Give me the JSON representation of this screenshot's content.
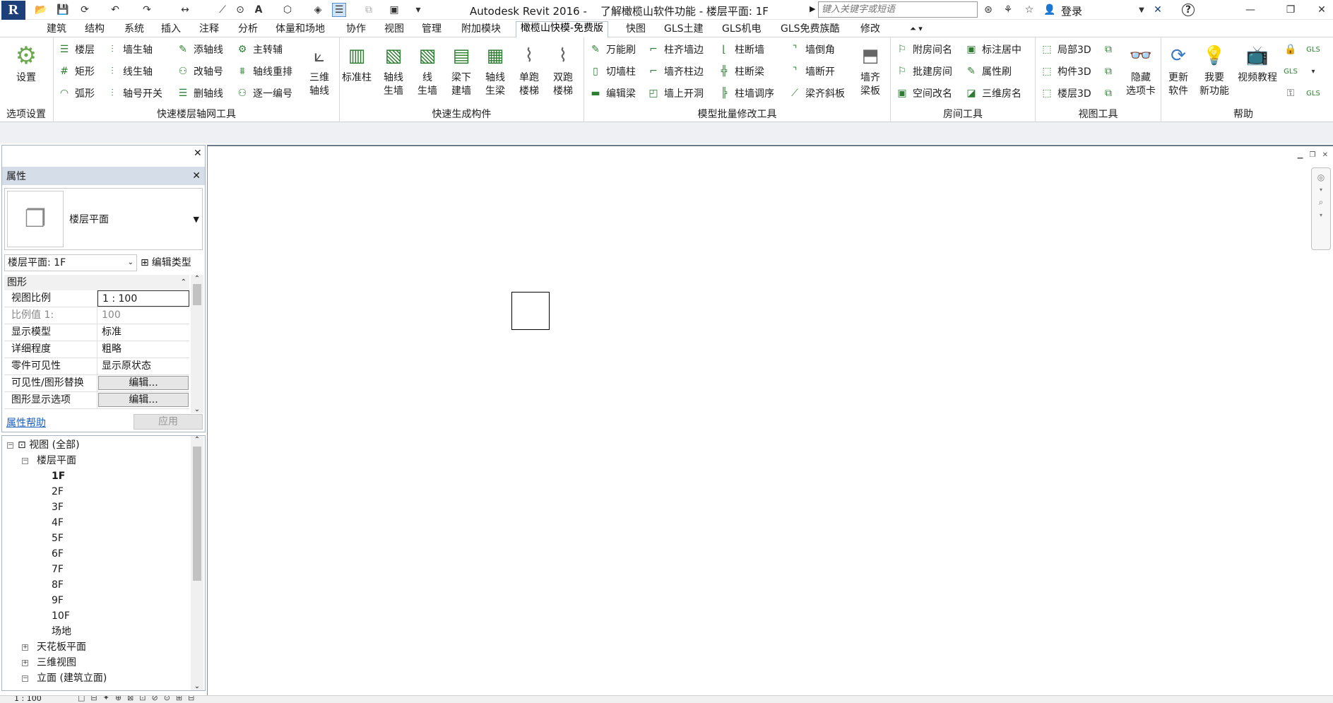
{
  "app": {
    "title": "Autodesk Revit 2016 -    了解橄榄山软件功能 - 楼层平面: 1F",
    "search_placeholder": "键入关键字或短语",
    "login_label": "登录"
  },
  "tabs": [
    "建筑",
    "结构",
    "系统",
    "插入",
    "注释",
    "分析",
    "体量和场地",
    "协作",
    "视图",
    "管理",
    "附加模块",
    "橄榄山快模-免费版",
    "快图",
    "GLS土建",
    "GLS机电",
    "GLS免费族酷",
    "修改"
  ],
  "active_tab_index": 11,
  "ribbon": {
    "settings": {
      "label": "设置",
      "panel": "选项设置"
    },
    "axis_panel": {
      "title": "快速楼层轴网工具",
      "col1": [
        "楼层",
        "矩形",
        "弧形"
      ],
      "col2": [
        "墙生轴",
        "线生轴",
        "轴号开关"
      ],
      "col3": [
        "添轴线",
        "改轴号",
        "删轴线"
      ],
      "col4": [
        "主转辅",
        "轴线重排",
        "逐一编号"
      ],
      "big": "三维\n轴线"
    },
    "component_panel": {
      "title": "快速生成构件",
      "big": [
        "标准柱",
        "轴线\n生墙",
        "线\n生墙",
        "梁下\n建墙",
        "轴线\n生梁",
        "单跑\n楼梯",
        "双跑\n楼梯"
      ]
    },
    "modify_panel": {
      "title": "模型批量修改工具",
      "col1": [
        "万能刷",
        "切墙柱",
        "编辑梁"
      ],
      "col2": [
        "柱齐墙边",
        "墙齐柱边",
        "墙上开洞"
      ],
      "col3": [
        "柱断墙",
        "柱断梁",
        "柱墙调序"
      ],
      "col4": [
        "墙倒角",
        "墙断开",
        "梁齐斜板"
      ],
      "big": "墙齐\n梁板"
    },
    "room_panel": {
      "title": "房间工具",
      "col1": [
        "附房间名",
        "批建房间",
        "空间改名"
      ],
      "col2": [
        "标注居中",
        "属性刷",
        "三维房名"
      ]
    },
    "view_panel": {
      "title": "视图工具",
      "col1": [
        "局部3D",
        "构件3D",
        "楼层3D"
      ],
      "big": "隐藏\n选项卡"
    },
    "help_panel": {
      "title": "帮助",
      "big": [
        "更新\n软件",
        "我要\n新功能",
        "视频教程"
      ]
    }
  },
  "properties": {
    "panel_title": "属性",
    "type_name": "楼层平面",
    "instance_selector": "楼层平面: 1F",
    "edit_type_label": "编辑类型",
    "group_label": "图形",
    "rows": [
      {
        "key": "视图比例",
        "value": "1 : 100"
      },
      {
        "key": "比例值 1:",
        "value": "100"
      },
      {
        "key": "显示模型",
        "value": "标准"
      },
      {
        "key": "详细程度",
        "value": "粗略"
      },
      {
        "key": "零件可见性",
        "value": "显示原状态"
      },
      {
        "key": "可见性/图形替换",
        "value": "编辑..."
      },
      {
        "key": "图形显示选项",
        "value": "编辑..."
      }
    ],
    "help_link": "属性帮助",
    "apply_label": "应用"
  },
  "browser": {
    "root": "视图 (全部)",
    "floor_plans": "楼层平面",
    "levels": [
      "1F",
      "2F",
      "3F",
      "4F",
      "5F",
      "6F",
      "7F",
      "8F",
      "9F",
      "10F",
      "场地"
    ],
    "ceiling_plans": "天花板平面",
    "views_3d": "三维视图",
    "elevations": "立面 (建筑立面)"
  },
  "status": {
    "scale": "1 : 100"
  }
}
